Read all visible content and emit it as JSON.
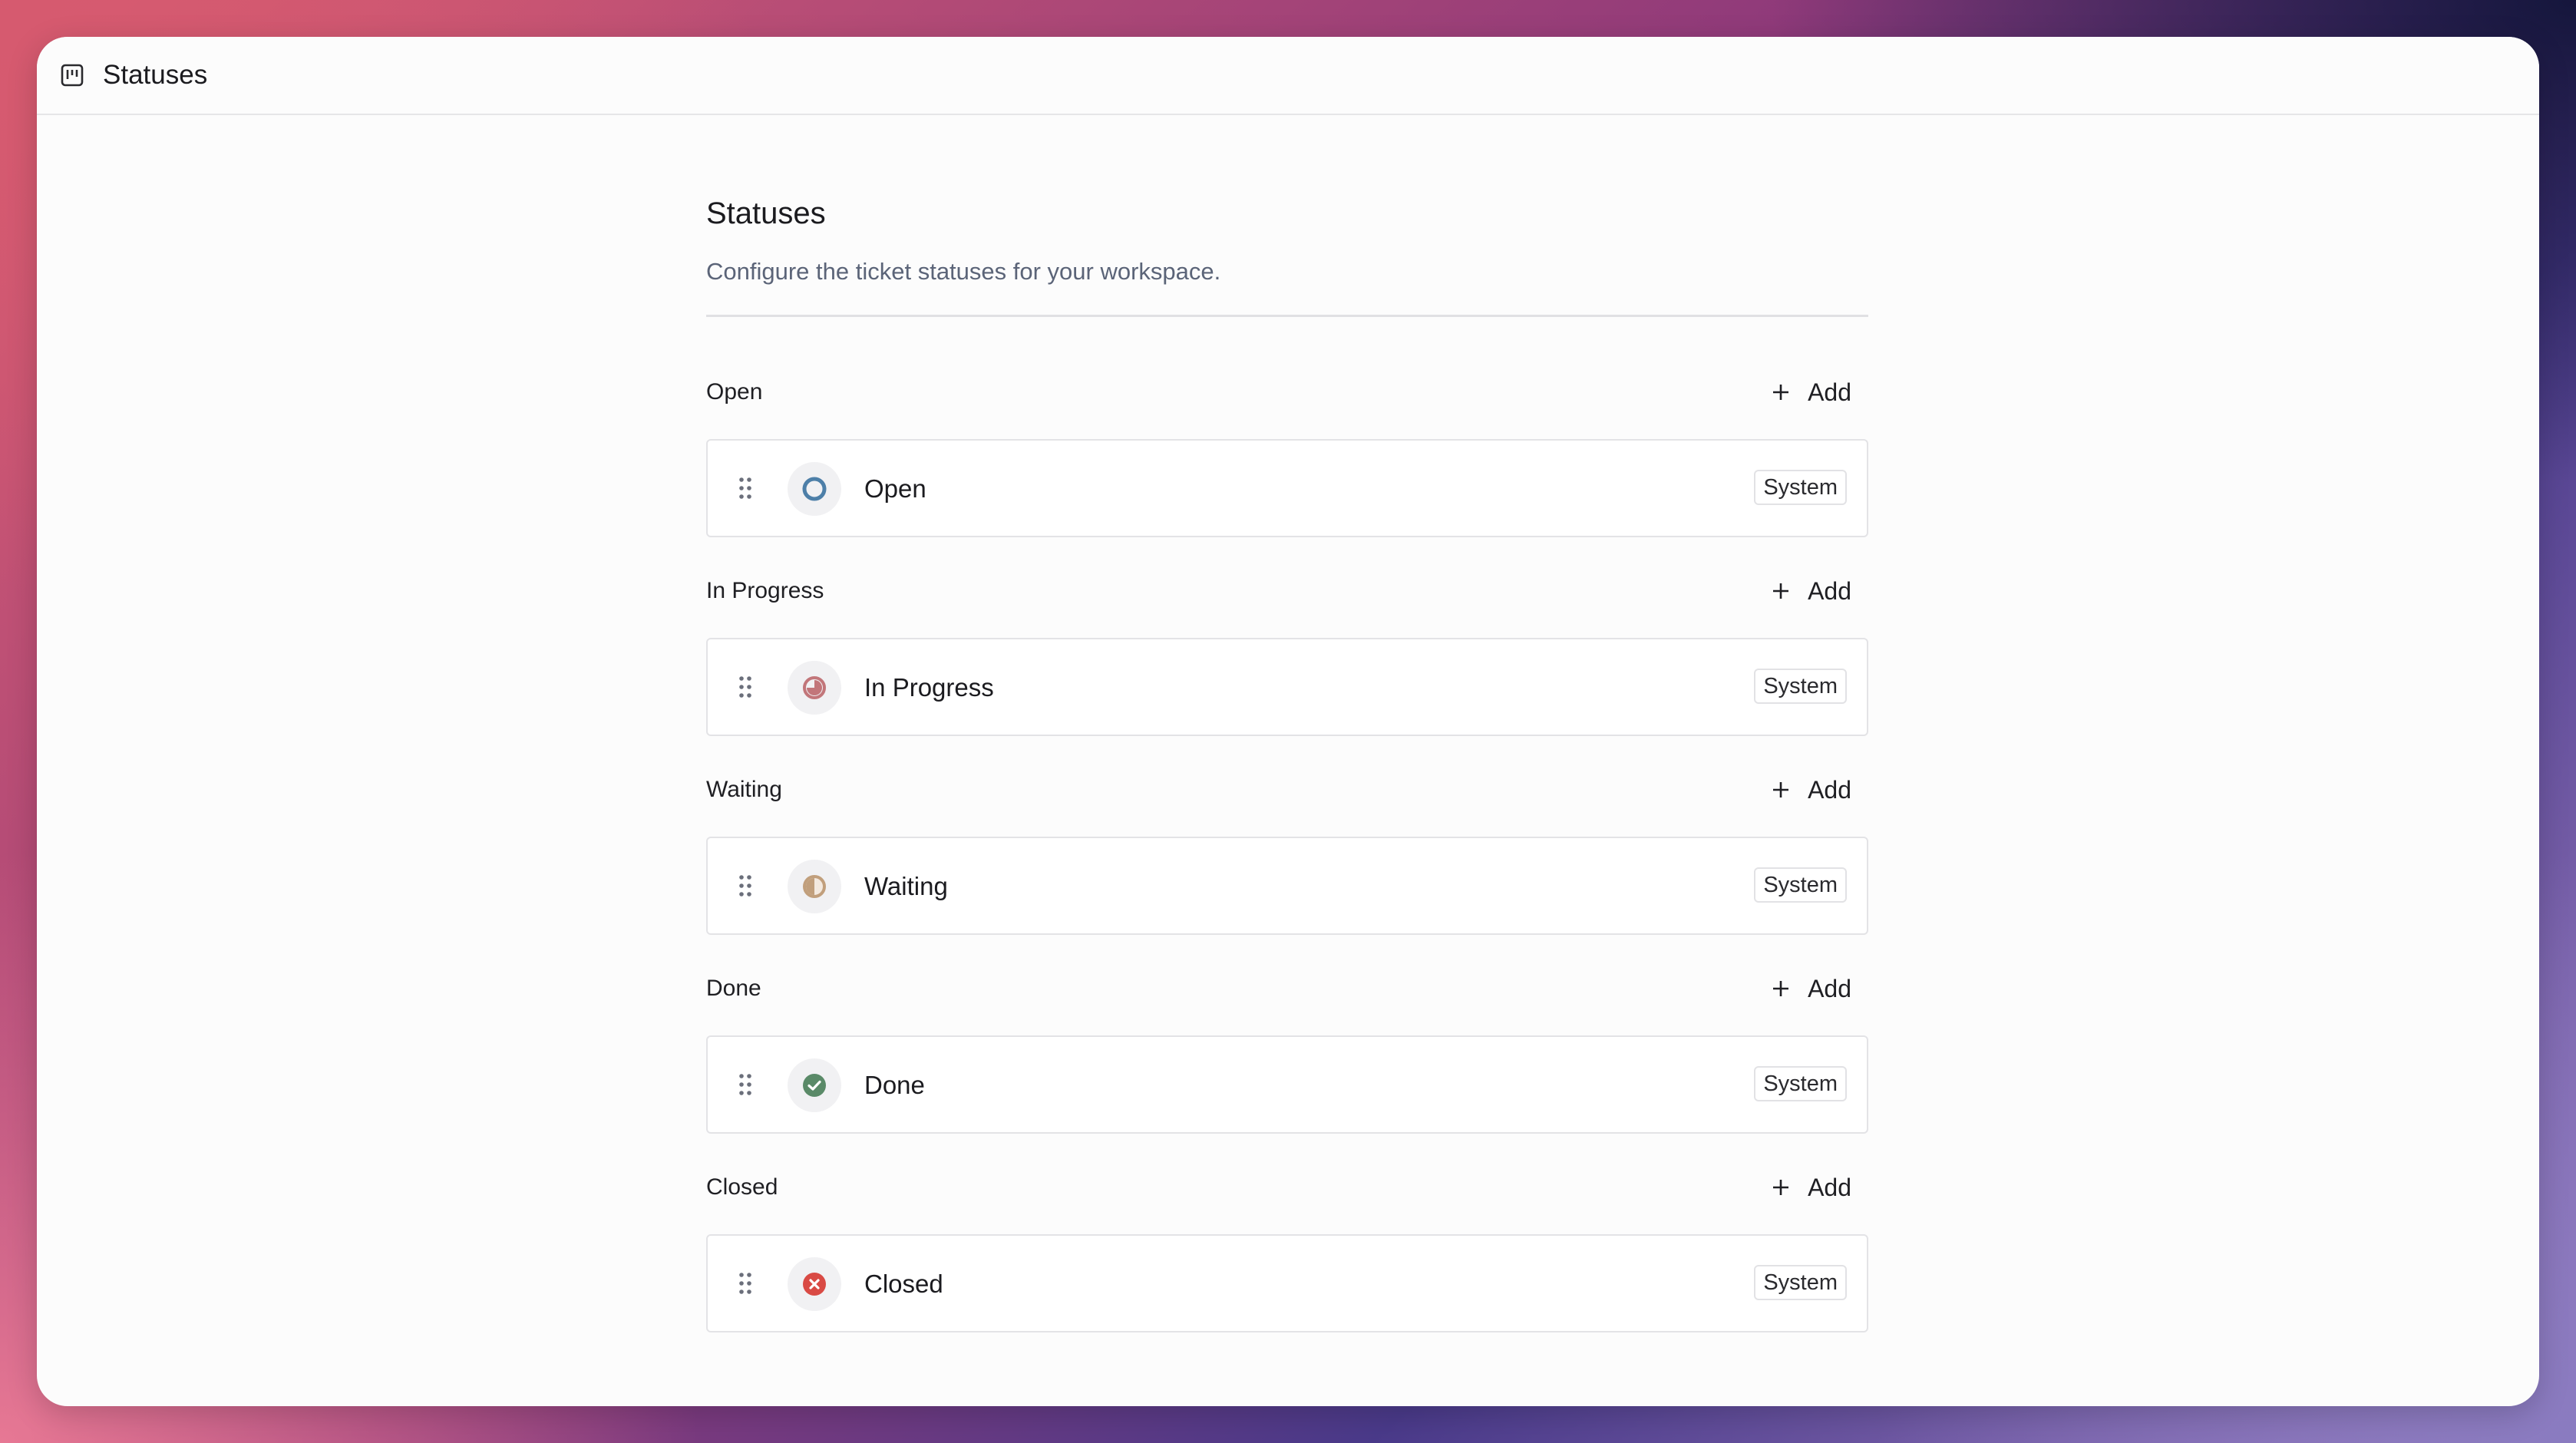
{
  "window": {
    "title": "Statuses",
    "icon": "kanban-board-icon"
  },
  "page": {
    "title": "Statuses",
    "description": "Configure the ticket statuses for your workspace."
  },
  "add_label": "Add",
  "groups": [
    {
      "label": "Open",
      "status": {
        "name": "Open",
        "badge": "System",
        "icon": "circle-outline-icon",
        "color": "#4d7fa8"
      }
    },
    {
      "label": "In Progress",
      "status": {
        "name": "In Progress",
        "badge": "System",
        "icon": "half-progress-icon",
        "color": "#c2767a"
      }
    },
    {
      "label": "Waiting",
      "status": {
        "name": "Waiting",
        "badge": "System",
        "icon": "half-circle-icon",
        "color": "#c19f7c"
      }
    },
    {
      "label": "Done",
      "status": {
        "name": "Done",
        "badge": "System",
        "icon": "check-circle-icon",
        "color": "#5a8a68"
      }
    },
    {
      "label": "Closed",
      "status": {
        "name": "Closed",
        "badge": "System",
        "icon": "x-circle-icon",
        "color": "#d94a44"
      }
    }
  ]
}
